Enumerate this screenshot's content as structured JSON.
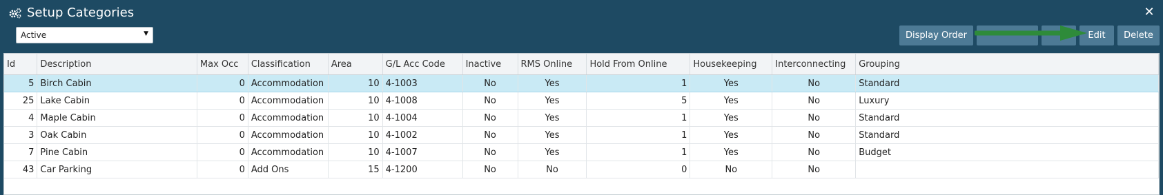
{
  "window": {
    "title": "Setup Categories",
    "close_glyph": "✕"
  },
  "filter": {
    "status_value": "Active"
  },
  "toolbar": {
    "display_order_label": "Display Order",
    "blank1_label": "",
    "blank2_label": "",
    "edit_label": "Edit",
    "delete_label": "Delete",
    "annotation": {
      "type": "arrow",
      "color": "#2e8b3a",
      "points_to": "edit-button"
    }
  },
  "colors": {
    "header_bg": "#1e4a63",
    "button_bg": "#4d7a95",
    "selected_row": "#c9eaf5",
    "arrow": "#2e8b3a"
  },
  "icons": {
    "title": "gears-icon",
    "close": "close-icon",
    "dropdown": "chevron-down-icon"
  },
  "table": {
    "columns": [
      "Id",
      "Description",
      "Max Occ",
      "Classification",
      "Area",
      "G/L Acc Code",
      "Inactive",
      "RMS Online",
      "Hold From Online",
      "Housekeeping",
      "Interconnecting",
      "Grouping"
    ],
    "rows": [
      {
        "id": "5",
        "description": "Birch Cabin",
        "max_occ": "0",
        "classification": "Accommodation",
        "area": "10",
        "gl_code": "4-1003",
        "inactive": "No",
        "rms_online": "Yes",
        "hold_from_online": "1",
        "housekeeping": "Yes",
        "interconnecting": "No",
        "grouping": "Standard",
        "selected": true
      },
      {
        "id": "25",
        "description": "Lake Cabin",
        "max_occ": "0",
        "classification": "Accommodation",
        "area": "10",
        "gl_code": "4-1008",
        "inactive": "No",
        "rms_online": "Yes",
        "hold_from_online": "5",
        "housekeeping": "Yes",
        "interconnecting": "No",
        "grouping": "Luxury",
        "selected": false
      },
      {
        "id": "4",
        "description": "Maple Cabin",
        "max_occ": "0",
        "classification": "Accommodation",
        "area": "10",
        "gl_code": "4-1004",
        "inactive": "No",
        "rms_online": "Yes",
        "hold_from_online": "1",
        "housekeeping": "Yes",
        "interconnecting": "No",
        "grouping": "Standard",
        "selected": false
      },
      {
        "id": "3",
        "description": "Oak Cabin",
        "max_occ": "0",
        "classification": "Accommodation",
        "area": "10",
        "gl_code": "4-1002",
        "inactive": "No",
        "rms_online": "Yes",
        "hold_from_online": "1",
        "housekeeping": "Yes",
        "interconnecting": "No",
        "grouping": "Standard",
        "selected": false
      },
      {
        "id": "7",
        "description": "Pine Cabin",
        "max_occ": "0",
        "classification": "Accommodation",
        "area": "10",
        "gl_code": "4-1007",
        "inactive": "No",
        "rms_online": "Yes",
        "hold_from_online": "1",
        "housekeeping": "Yes",
        "interconnecting": "No",
        "grouping": "Budget",
        "selected": false
      },
      {
        "id": "43",
        "description": "Car Parking",
        "max_occ": "0",
        "classification": "Add Ons",
        "area": "15",
        "gl_code": "4-1200",
        "inactive": "No",
        "rms_online": "No",
        "hold_from_online": "0",
        "housekeeping": "No",
        "interconnecting": "No",
        "grouping": "",
        "selected": false
      }
    ]
  }
}
